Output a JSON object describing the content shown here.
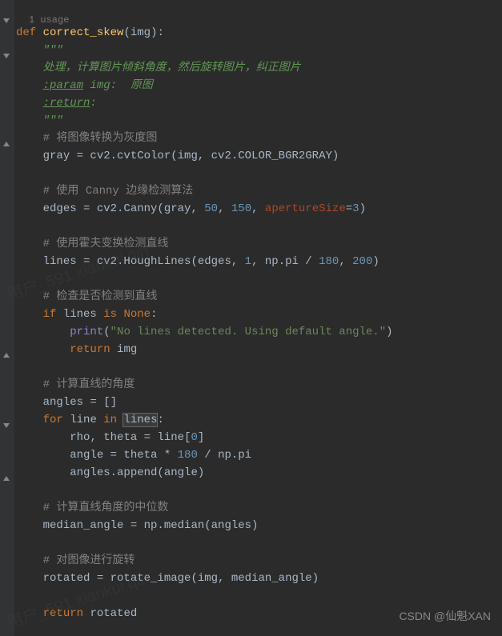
{
  "usage_hint": "1 usage",
  "code": {
    "def_kw": "def",
    "fn_name": "correct_skew",
    "param": "img",
    "docstring_open": "\"\"\"",
    "doc_line1": "处理，计算图片倾斜角度，然后旋转图片，纠正图片",
    "doc_param_tag": ":param",
    "doc_param_rest": " img:  原图",
    "doc_return_tag": ":return",
    "doc_return_rest": ":",
    "docstring_close": "\"\"\"",
    "c1": "# 将图像转换为灰度图",
    "gray_lhs": "gray = cv2.cvtColor(img",
    "gray_enum": "cv2.COLOR_BGR2GRAY",
    "c2": "# 使用 Canny 边缘检测算法",
    "edges_lhs": "edges = cv2.Canny(gray",
    "n50": "50",
    "n150": "150",
    "ap_name": "apertureSize",
    "n3": "3",
    "c3": "# 使用霍夫变换检测直线",
    "lines_lhs": "lines = cv2.HoughLines(edges",
    "n1": "1",
    "np_pi": "np.pi",
    "n180": "180",
    "n200": "200",
    "c4": "# 检查是否检测到直线",
    "if_kw": "if",
    "lines_var": "lines",
    "is_kw": "is",
    "none_kw": "None",
    "print_fn": "print",
    "print_str": "\"No lines detected. Using default angle.\"",
    "return_kw": "return",
    "img_var": "img",
    "c5": "# 计算直线的角度",
    "angles_init": "angles = []",
    "for_kw": "for",
    "line_var": "line",
    "in_kw": "in",
    "lines_hl": "lines",
    "n0": "0",
    "rho_theta": "rho",
    "theta_var": "theta = line[",
    "angle_line": "angle = theta * ",
    "div_nppi": " / np.pi",
    "append_line": "angles.append(angle)",
    "c6": "# 计算直线角度的中位数",
    "median_line": "median_angle = np.median(angles)",
    "c7": "# 对图像进行旋转",
    "rotated_lhs": "rotated = rotate_image(img",
    "median_var": "median_angle",
    "rotated_var": "rotated"
  },
  "watermarks": {
    "wm1": "用户_591 xiankui.qin",
    "wm2": "用户_591 xiankui.qin",
    "footer": "CSDN @仙魁XAN"
  }
}
